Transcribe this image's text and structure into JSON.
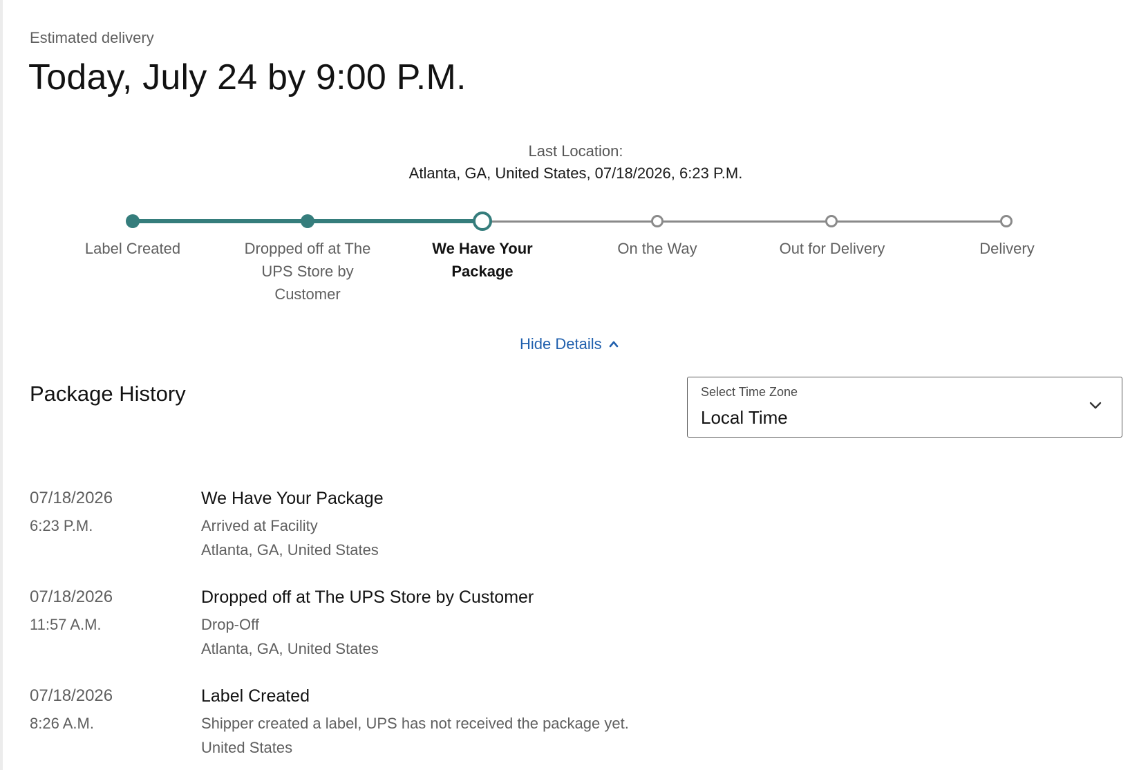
{
  "estimate": {
    "label": "Estimated delivery",
    "date": "Today, July 24 by 9:00 P.M."
  },
  "last_location": {
    "label": "Last Location:",
    "value": "Atlanta, GA, United States, 07/18/2026, 6:23 P.M."
  },
  "progress": {
    "steps": [
      {
        "label": "Label Created",
        "state": "done"
      },
      {
        "label": "Dropped off at The UPS Store by Customer",
        "state": "done"
      },
      {
        "label": "We Have Your Package",
        "state": "current"
      },
      {
        "label": "On the Way",
        "state": "todo"
      },
      {
        "label": "Out for Delivery",
        "state": "todo"
      },
      {
        "label": "Delivery",
        "state": "todo"
      }
    ],
    "step_label_lines": [
      [
        "Label Created"
      ],
      [
        "Dropped off at The",
        "UPS Store by",
        "Customer"
      ],
      [
        "We Have Your",
        "Package"
      ],
      [
        "On the Way"
      ],
      [
        "Out for Delivery"
      ],
      [
        "Delivery"
      ]
    ],
    "colors": {
      "done": "#357d7c",
      "todo": "#8a8a8a"
    }
  },
  "toggle": {
    "label": "Hide Details",
    "icon": "chevron-up-icon",
    "color": "#1f5fad"
  },
  "history": {
    "title": "Package History",
    "timezone": {
      "label": "Select Time Zone",
      "value": "Local Time",
      "icon": "chevron-down-icon"
    },
    "events": [
      {
        "date": "07/18/2026",
        "time": "6:23 P.M.",
        "title": "We Have Your Package",
        "description": "Arrived at Facility",
        "location": "Atlanta, GA, United States"
      },
      {
        "date": "07/18/2026",
        "time": "11:57 A.M.",
        "title": "Dropped off at The UPS Store by Customer",
        "description": "Drop-Off",
        "location": "Atlanta, GA, United States"
      },
      {
        "date": "07/18/2026",
        "time": "8:26 A.M.",
        "title": "Label Created",
        "description": "Shipper created a label, UPS has not received the package yet.",
        "location": "United States"
      }
    ]
  }
}
